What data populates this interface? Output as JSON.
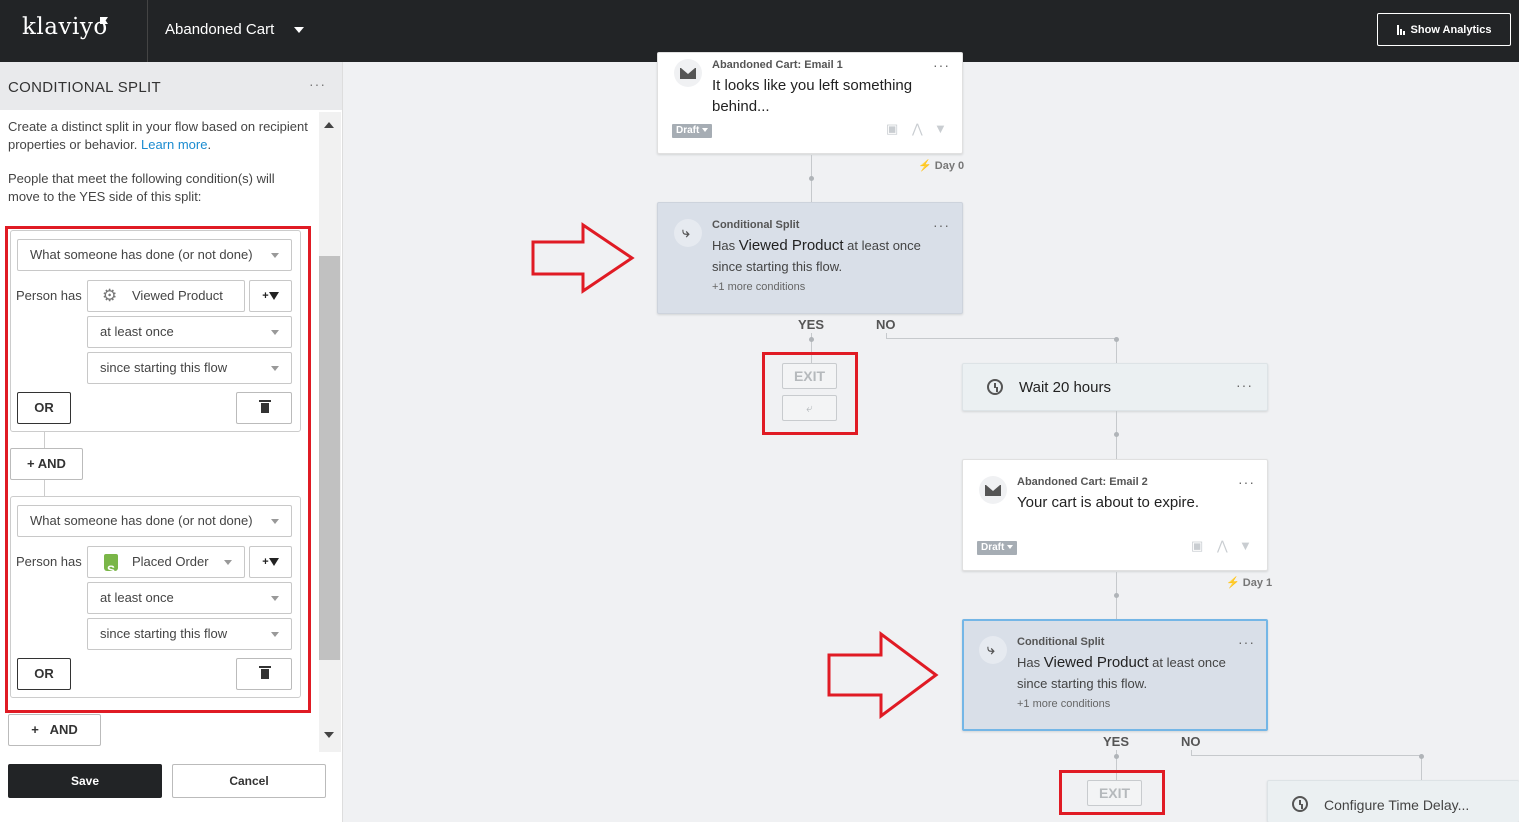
{
  "topbar": {
    "logo": "klaviyo",
    "flow_name": "Abandoned Cart",
    "analytics_label": "Show Analytics"
  },
  "panel": {
    "title": "CONDITIONAL SPLIT",
    "menu": "···",
    "description": "Create a distinct split in your flow based on recipient properties or behavior.",
    "learn_more": "Learn more",
    "rule_text": "People that meet the following condition(s) will move to the YES side of this split:",
    "groups": [
      {
        "type": "What someone has done (or not done)",
        "person_has": "Person has",
        "metric": "Viewed Product",
        "metric_icon": "gear-icon",
        "frequency": "at least once",
        "timeframe": "since starting this flow",
        "or_label": "OR"
      },
      {
        "type": "What someone has done (or not done)",
        "person_has": "Person has",
        "metric": "Placed Order",
        "metric_icon": "shopify-icon",
        "frequency": "at least once",
        "timeframe": "since starting this flow",
        "or_label": "OR"
      }
    ],
    "and_label": "AND",
    "and_add": "+",
    "filter_plus": "+",
    "save_label": "Save",
    "cancel_label": "Cancel"
  },
  "canvas": {
    "email1": {
      "kicker": "Abandoned Cart: Email 1",
      "subject": "It looks like you left something behind...",
      "status": "Draft",
      "day": "Day 0",
      "menu": "···"
    },
    "split1": {
      "kicker": "Conditional Split",
      "cond_prefix": "Has",
      "cond_metric": "Viewed Product",
      "cond_suffix": "at least once",
      "cond_line2": "since starting this flow.",
      "more": "+1 more conditions",
      "yes": "YES",
      "no": "NO",
      "exit": "EXIT",
      "menu": "···"
    },
    "wait": {
      "label": "Wait 20 hours",
      "menu": "···"
    },
    "email2": {
      "kicker": "Abandoned Cart: Email 2",
      "subject": "Your cart is about to expire.",
      "status": "Draft",
      "day": "Day 1",
      "menu": "···"
    },
    "split2": {
      "kicker": "Conditional Split",
      "cond_prefix": "Has",
      "cond_metric": "Viewed Product",
      "cond_suffix": "at least once",
      "cond_line2": "since starting this flow.",
      "more": "+1 more conditions",
      "yes": "YES",
      "no": "NO",
      "exit": "EXIT",
      "menu": "···"
    },
    "delay": {
      "label": "Configure Time Delay..."
    }
  },
  "colors": {
    "topbar": "#222426",
    "accent_link": "#1a8bd0",
    "annotation_red": "#e01b24",
    "split_card": "#d9dfe8",
    "selected_border": "#74b6e6"
  }
}
